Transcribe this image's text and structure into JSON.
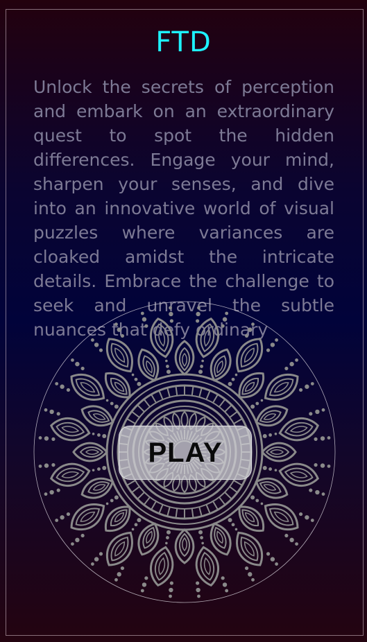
{
  "app": {
    "title": "FTD"
  },
  "intro": {
    "text": "Unlock the secrets of perception and embark on an extraordinary quest to spot the hidden differences. Engage your mind, sharpen your senses, and dive into an innovative world of visual puzzles where variances are cloaked amidst the intricate details. Embrace the challenge to seek and unravel the subtle nuances that defy ordinary"
  },
  "play_button": {
    "label": "PLAY"
  },
  "mandala": {
    "icon": "mandala-icon"
  },
  "colors": {
    "title": "#1df2ff",
    "text": "#7d7a95",
    "mandala": "#8a8a8a",
    "background_top": "#23010e",
    "background_mid": "#01033a",
    "background_bottom": "#240410"
  }
}
